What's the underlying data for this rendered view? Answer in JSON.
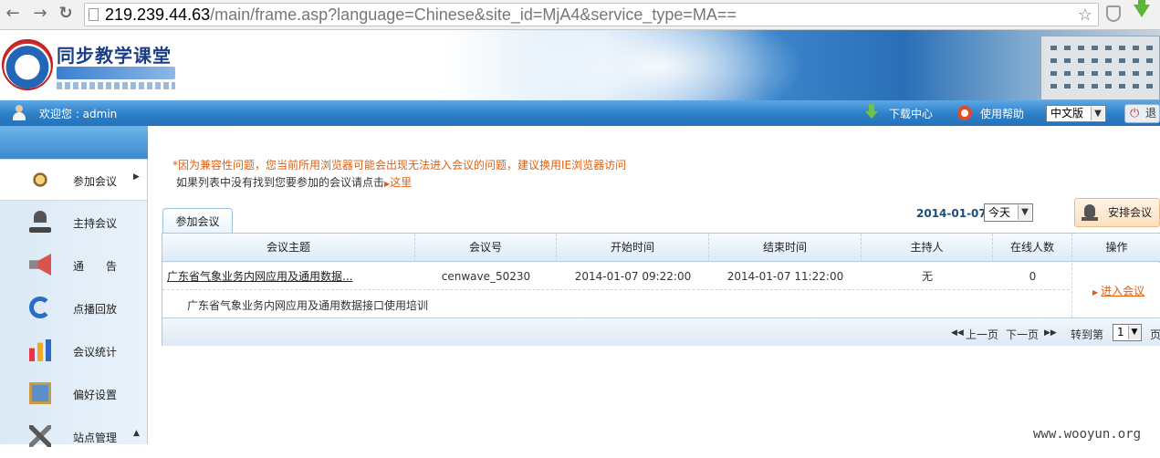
{
  "browser": {
    "url_host": "219.239.44.63",
    "url_rest": "/main/frame.asp?language=Chinese&site_id=MjA4&service_type=MA=="
  },
  "banner": {
    "title": "同步教学课堂"
  },
  "topbar": {
    "welcome": "欢迎您 : admin",
    "download": "下载中心",
    "help": "使用帮助",
    "language": "中文版",
    "logout": "退"
  },
  "sidebar": {
    "items": [
      {
        "label": "参加会议"
      },
      {
        "label": "主持会议"
      },
      {
        "label": "通　　告"
      },
      {
        "label": "点播回放"
      },
      {
        "label": "会议统计"
      },
      {
        "label": "偏好设置"
      },
      {
        "label": "站点管理"
      }
    ]
  },
  "notice": {
    "warning": "*因为兼容性问题，您当前所用浏览器可能会出现无法进入会议的问题，建议换用IE浏览器访问",
    "hint": "如果列表中没有找到您要参加的会议请点击",
    "hint_link": "这里"
  },
  "filter": {
    "date": "2014-01-07",
    "range": "今天",
    "arrange_button": "安排会议"
  },
  "tab": {
    "label": "参加会议"
  },
  "table": {
    "headers": [
      "会议主题",
      "会议号",
      "开始时间",
      "结束时间",
      "主持人",
      "在线人数",
      "操作"
    ],
    "rows": [
      {
        "topic": "广东省气象业务内网应用及通用数据...",
        "number": "cenwave_50230",
        "start": "2014-01-07 09:22:00",
        "end": "2014-01-07 11:22:00",
        "host": "无",
        "online": "0",
        "action": "进入会议",
        "description": "广东省气象业务内网应用及通用数据接口使用培训"
      }
    ]
  },
  "pager": {
    "prev": "上一页",
    "next": "下一页",
    "goto": "转到第",
    "page": "1",
    "page_unit": "页"
  },
  "watermark": "www.wooyun.org"
}
